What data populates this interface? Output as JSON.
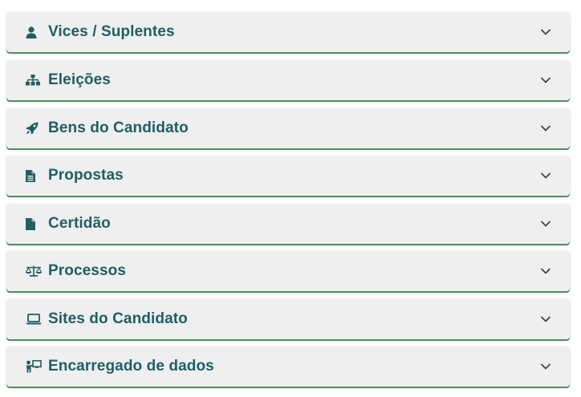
{
  "accordion": {
    "items": [
      {
        "label": "Vices / Suplentes",
        "icon": "user-icon"
      },
      {
        "label": "Eleições",
        "icon": "sitemap-icon"
      },
      {
        "label": "Bens do Candidato",
        "icon": "rocket-icon"
      },
      {
        "label": "Propostas",
        "icon": "file-text-icon"
      },
      {
        "label": "Certidão",
        "icon": "file-icon"
      },
      {
        "label": "Processos",
        "icon": "balance-scale-icon"
      },
      {
        "label": "Sites do Candidato",
        "icon": "laptop-icon"
      },
      {
        "label": "Encarregado de dados",
        "icon": "person-chalkboard-icon"
      }
    ]
  },
  "colors": {
    "text": "#1f5f66",
    "panel_bg": "#efefef",
    "accent_border": "#4f8f5a",
    "chevron": "#444444"
  }
}
